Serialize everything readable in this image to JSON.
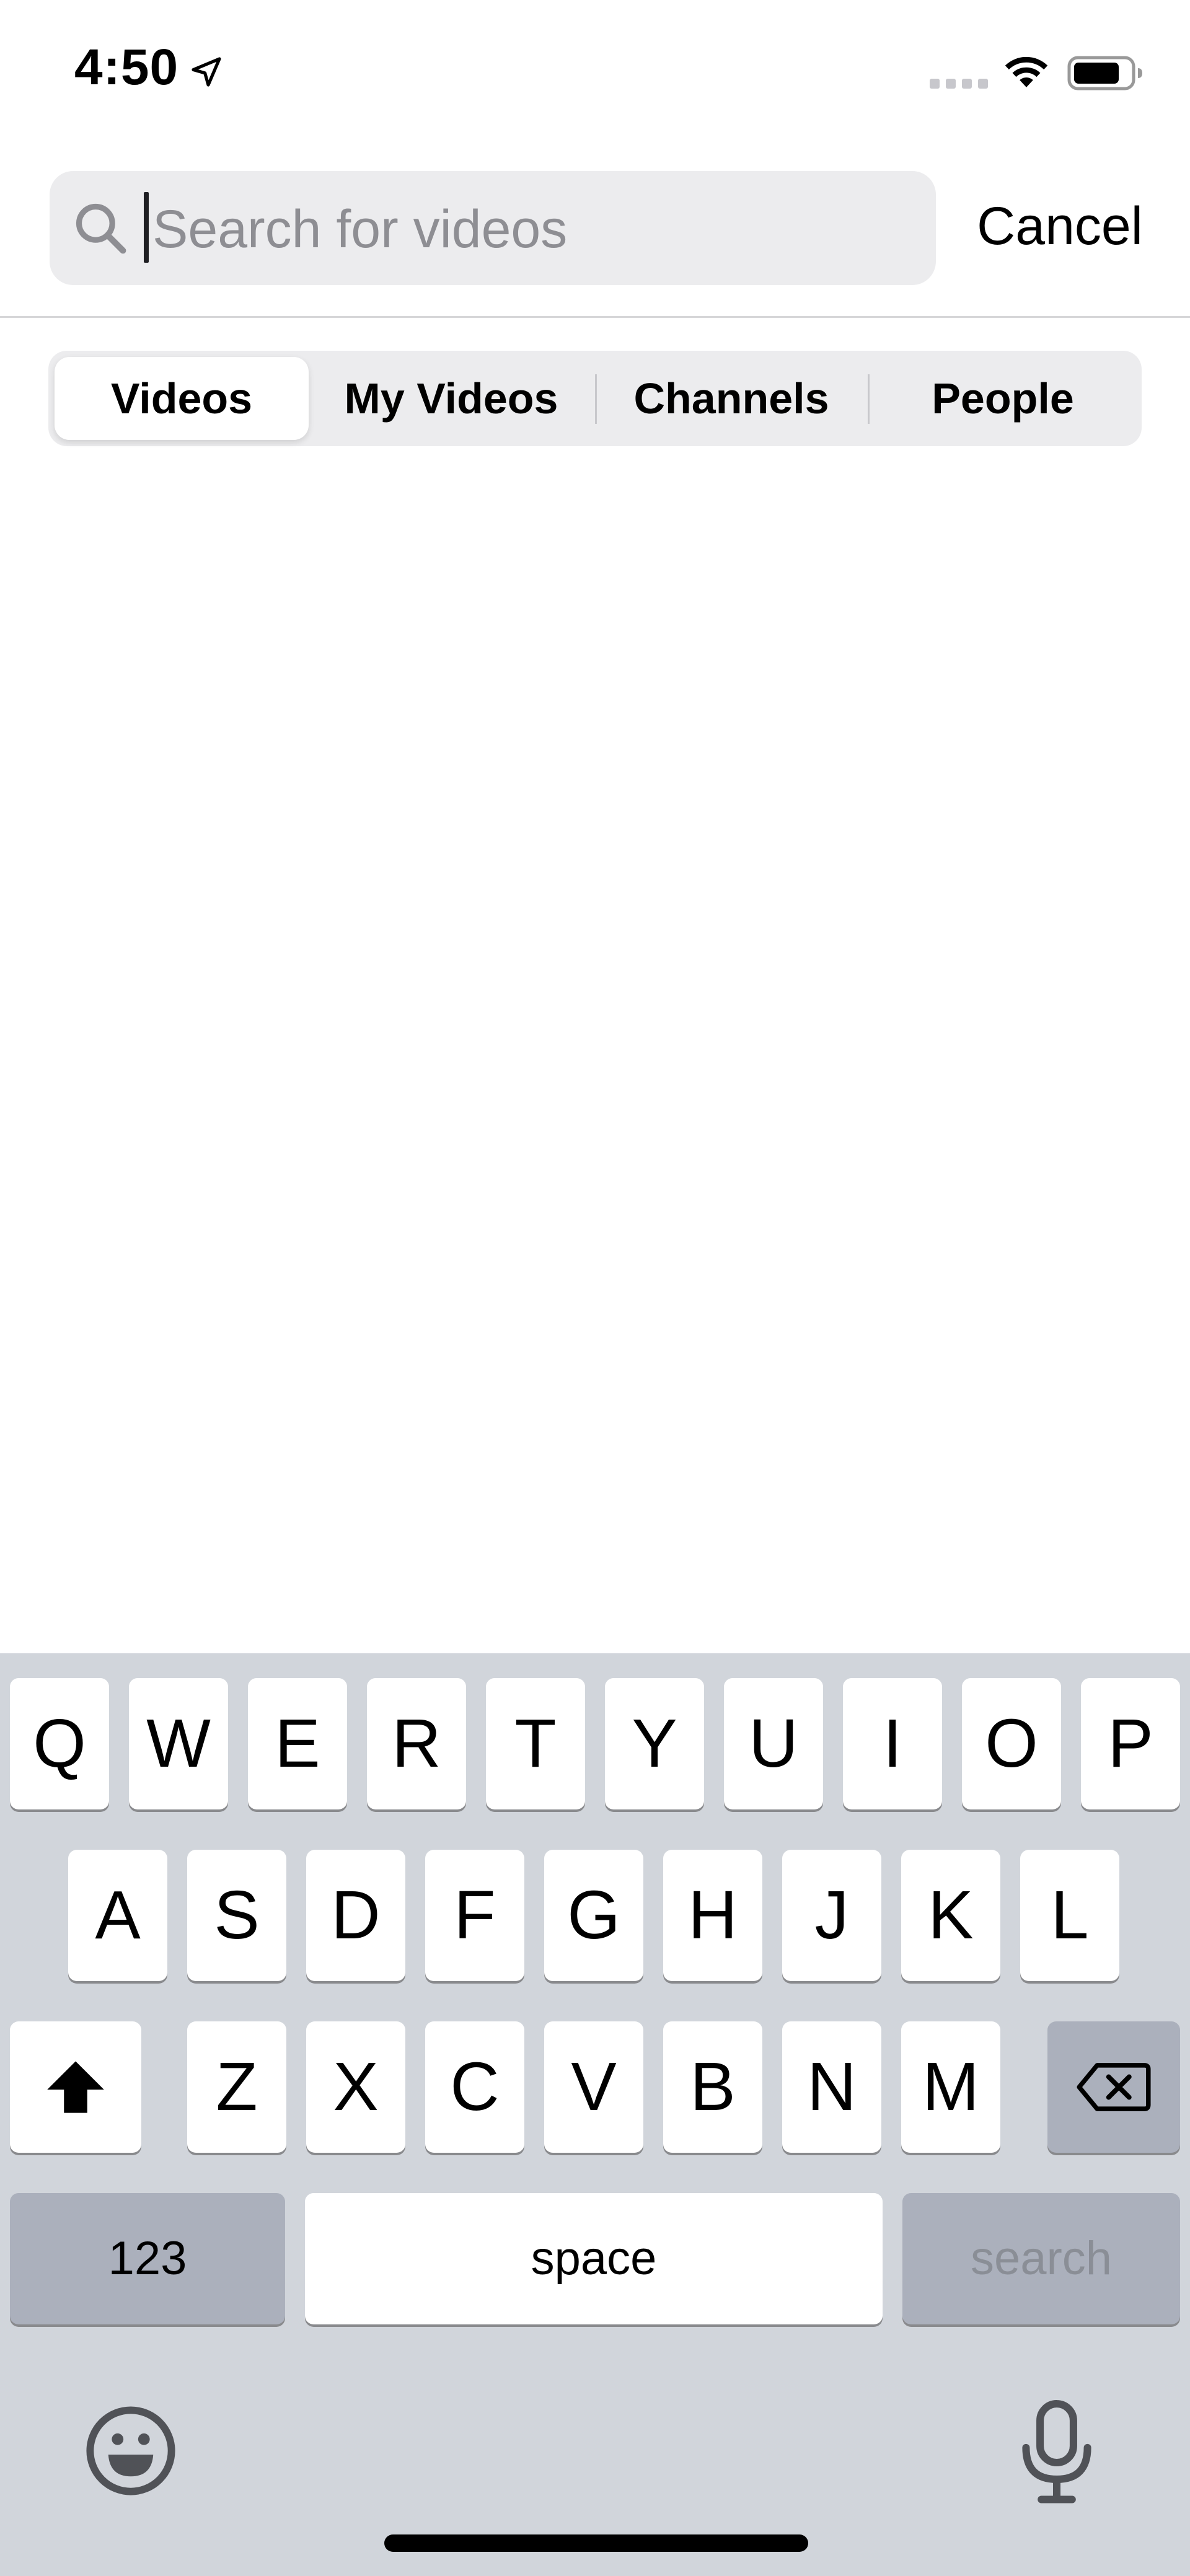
{
  "status_bar": {
    "time": "4:50",
    "icons": [
      "location-arrow-icon",
      "signal-icon",
      "wifi-icon",
      "battery-icon"
    ]
  },
  "search": {
    "placeholder": "Search for videos",
    "value": "",
    "cancel_label": "Cancel",
    "icon": "search-icon"
  },
  "tabs": [
    {
      "label": "Videos",
      "selected": true
    },
    {
      "label": "My Videos",
      "selected": false
    },
    {
      "label": "Channels",
      "selected": false
    },
    {
      "label": "People",
      "selected": false
    }
  ],
  "keyboard": {
    "row1": [
      "Q",
      "W",
      "E",
      "R",
      "T",
      "Y",
      "U",
      "I",
      "O",
      "P"
    ],
    "row2": [
      "A",
      "S",
      "D",
      "F",
      "G",
      "H",
      "J",
      "K",
      "L"
    ],
    "row3": [
      "Z",
      "X",
      "C",
      "V",
      "B",
      "N",
      "M"
    ],
    "numbers_label": "123",
    "space_label": "space",
    "search_label": "search",
    "icons": [
      "shift-icon",
      "backspace-icon",
      "emoji-icon",
      "microphone-icon"
    ]
  },
  "colors": {
    "keyboard_bg": "#d1d5db",
    "key_bg": "#ffffff",
    "special_key_bg": "#abb0bc",
    "search_field_bg": "#ececee",
    "placeholder": "#8e8e93"
  }
}
